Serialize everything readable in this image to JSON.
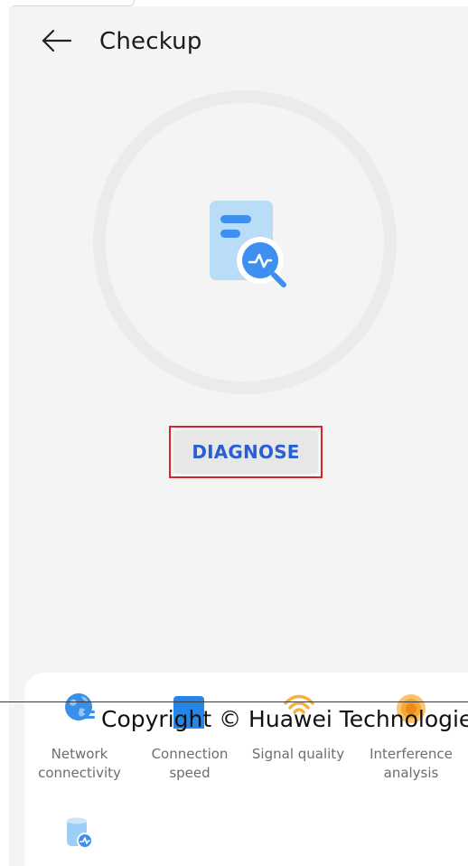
{
  "header": {
    "title": "Checkup",
    "back_icon": "arrow-left-icon"
  },
  "hero": {
    "icon": "document-search-icon",
    "accent": "#3d8ff0"
  },
  "diagnose": {
    "label": "DIAGNOSE",
    "color": "#2a5fd3",
    "highlight_color": "#d9232d"
  },
  "tools": {
    "items": [
      {
        "label_line1": "Network",
        "label_line2": "connectivity",
        "icon": "globe-icon"
      },
      {
        "label_line1": "Connection",
        "label_line2": "speed",
        "icon": "speedometer-icon"
      },
      {
        "label_line1": "Signal quality",
        "label_line2": "",
        "icon": "wifi-signal-icon"
      },
      {
        "label_line1": "Interference",
        "label_line2": "analysis",
        "icon": "radar-icon"
      }
    ],
    "extra_icon": "storage-diagnose-icon"
  },
  "footer": {
    "copyright": "Copyright © Huawei Technologies"
  }
}
